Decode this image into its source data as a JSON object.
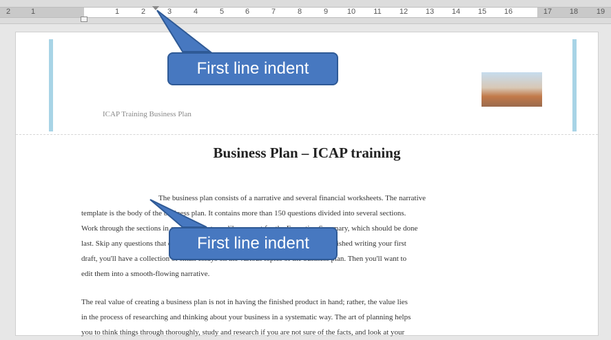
{
  "ruler": {
    "ticks": [
      "2",
      "1",
      "1",
      "2",
      "3",
      "4",
      "5",
      "6",
      "7",
      "8",
      "9",
      "10",
      "11",
      "12",
      "13",
      "14",
      "15",
      "16",
      "17",
      "18",
      "19"
    ]
  },
  "header": {
    "text": "ICAP Training Business Plan"
  },
  "document": {
    "title": "Business Plan – ICAP training",
    "paragraph1": [
      "The business plan consists of a narrative and several financial worksheets. The narrative",
      "template is the body of the business plan. It contains more than 150 questions divided into several sections.",
      "Work through the sections in any order that you like, except for the Executive Summary, which should be done",
      "last. Skip any questions that do not apply to your type of business. When you are finished writing your first",
      "draft, you'll have a collection of small essays on the various topics of the business plan. Then you'll want to",
      "edit them into a smooth-flowing narrative."
    ],
    "paragraph2": [
      "The real value of creating a business plan is not in having the finished product in hand; rather, the value lies",
      "in the process of researching and thinking about your business in a systematic way. The art of planning helps",
      "you to think things through thoroughly, study and research if you are not sure of the facts, and look at your"
    ]
  },
  "callouts": {
    "top": "First line indent",
    "middle": "First line indent"
  },
  "colors": {
    "callout_fill": "#4778c0",
    "header_bar": "#a8d4e6"
  }
}
